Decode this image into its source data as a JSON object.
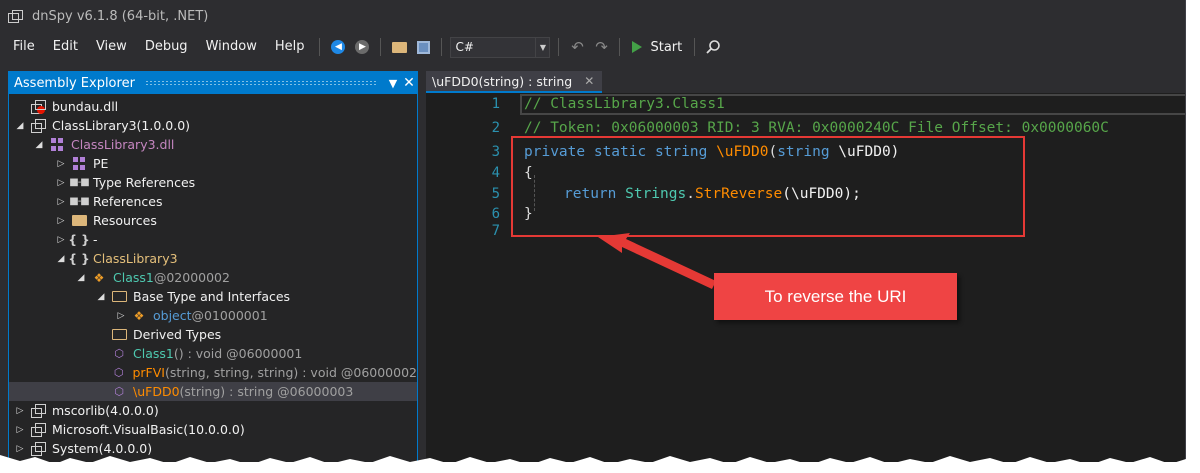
{
  "window": {
    "title": "dnSpy v6.1.8 (64-bit, .NET)"
  },
  "menu": [
    "File",
    "Edit",
    "View",
    "Debug",
    "Window",
    "Help"
  ],
  "toolbar": {
    "language": "C#",
    "start_label": "Start"
  },
  "explorer": {
    "title": "Assembly Explorer",
    "rows": [
      {
        "text": "bundau.dll",
        "extra": ""
      },
      {
        "text": "ClassLibrary3",
        "extra": " (1.0.0.0)"
      },
      {
        "text": "ClassLibrary3.dll",
        "extra": ""
      },
      {
        "text": "PE",
        "extra": ""
      },
      {
        "text": "Type References",
        "extra": ""
      },
      {
        "text": "References",
        "extra": ""
      },
      {
        "text": "Resources",
        "extra": ""
      },
      {
        "text": "-",
        "extra": ""
      },
      {
        "text": "ClassLibrary3",
        "extra": ""
      },
      {
        "text": "Class1",
        "extra": " @02000002"
      },
      {
        "text": "Base Type and Interfaces",
        "extra": ""
      },
      {
        "text": "object",
        "extra": " @01000001"
      },
      {
        "text": "Derived Types",
        "extra": ""
      },
      {
        "text": "Class1",
        "extra": "() : void @06000001"
      },
      {
        "text": "prFVI",
        "extra": "(string, string, string) : void @06000002"
      },
      {
        "text": "\\uFDD0",
        "extra": "(string) : string @06000003"
      },
      {
        "text": "mscorlib",
        "extra": " (4.0.0.0)"
      },
      {
        "text": "Microsoft.VisualBasic",
        "extra": " (10.0.0.0)"
      },
      {
        "text": "System",
        "extra": " (4.0.0.0)"
      }
    ]
  },
  "editor": {
    "tab_title": "\\uFDD0(string) : string",
    "line_numbers": [
      "1",
      "2",
      "3",
      "4",
      "5",
      "6",
      "7"
    ],
    "comment1": "// ClassLibrary3.Class1",
    "comment2": "// Token: 0x06000003 RID: 3 RVA: 0x0000240C File Offset: 0x0000060C",
    "l3_kw": "private static string ",
    "l3_name": "\\uFDD0",
    "l3_paren": "(",
    "l3_type": "string",
    "l3_arg": " \\uFDD0)",
    "l4": "{",
    "l5_ret": "return ",
    "l5_cls": "Strings",
    "l5_dot": ".",
    "l5_m": "StrReverse",
    "l5_args": "(\\uFDD0);",
    "l6": "}"
  },
  "annotation": {
    "callout": "To reverse the URI",
    "color": "#ef4444"
  }
}
